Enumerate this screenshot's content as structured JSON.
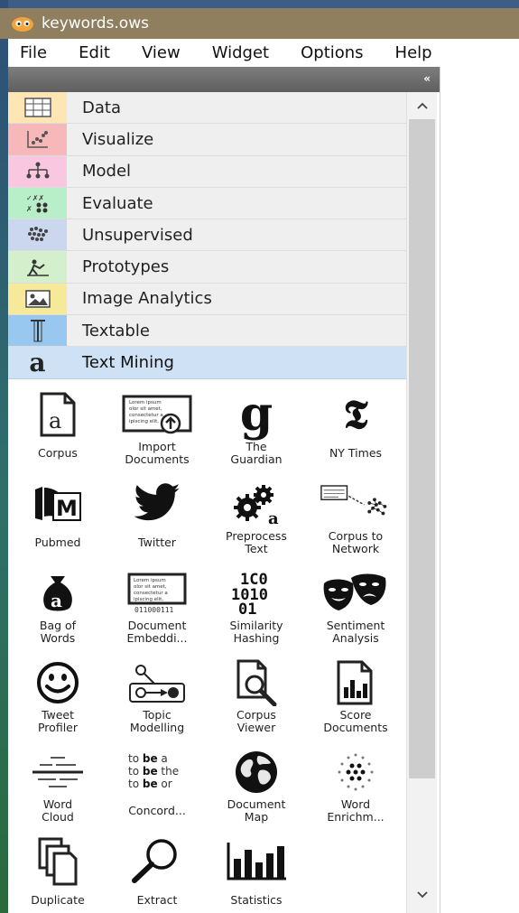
{
  "window": {
    "title": "keywords.ows"
  },
  "menu": [
    "File",
    "Edit",
    "View",
    "Widget",
    "Options",
    "Help"
  ],
  "dock": {
    "collapse_glyph": "«"
  },
  "categories": [
    {
      "label": "Data",
      "icon": "table-icon",
      "color": "#fde6b4"
    },
    {
      "label": "Visualize",
      "icon": "scatter-icon",
      "color": "#f6b8b8"
    },
    {
      "label": "Model",
      "icon": "tree-icon",
      "color": "#f9c7e0"
    },
    {
      "label": "Evaluate",
      "icon": "matrix-icon",
      "color": "#b8eec8"
    },
    {
      "label": "Unsupervised",
      "icon": "cluster-icon",
      "color": "#cad7ef"
    },
    {
      "label": "Prototypes",
      "icon": "digger-icon",
      "color": "#d4efcc"
    },
    {
      "label": "Image Analytics",
      "icon": "image-icon",
      "color": "#f6e99a"
    },
    {
      "label": "Textable",
      "icon": "text-cursor-icon",
      "color": "#98c8ef"
    },
    {
      "label": "Text Mining",
      "icon": "letter-a-icon",
      "color": "#cfe2f5",
      "selected": true
    }
  ],
  "widgets": [
    {
      "label": "Corpus",
      "icon": "corpus-icon"
    },
    {
      "label": "Import\nDocuments",
      "icon": "import-documents-icon"
    },
    {
      "label": "The\nGuardian",
      "icon": "guardian-icon"
    },
    {
      "label": "NY Times",
      "icon": "nytimes-icon"
    },
    {
      "label": "Pubmed",
      "icon": "pubmed-icon"
    },
    {
      "label": "Twitter",
      "icon": "twitter-icon"
    },
    {
      "label": "Preprocess\nText",
      "icon": "preprocess-icon"
    },
    {
      "label": "Corpus to\nNetwork",
      "icon": "corpus-network-icon"
    },
    {
      "label": "Bag of\nWords",
      "icon": "bag-of-words-icon"
    },
    {
      "label": "Document\nEmbeddi...",
      "icon": "document-embedding-icon"
    },
    {
      "label": "Similarity\nHashing",
      "icon": "similarity-hashing-icon"
    },
    {
      "label": "Sentiment\nAnalysis",
      "icon": "sentiment-icon"
    },
    {
      "label": "Tweet\nProfiler",
      "icon": "smiley-icon"
    },
    {
      "label": "Topic\nModelling",
      "icon": "topic-modelling-icon"
    },
    {
      "label": "Corpus\nViewer",
      "icon": "corpus-viewer-icon"
    },
    {
      "label": "Score\nDocuments",
      "icon": "score-documents-icon"
    },
    {
      "label": "Word\nCloud",
      "icon": "word-cloud-icon"
    },
    {
      "label": "Concord...",
      "icon": "concordance-icon"
    },
    {
      "label": "Document\nMap",
      "icon": "globe-icon"
    },
    {
      "label": "Word\nEnrichm...",
      "icon": "word-enrichment-icon"
    },
    {
      "label": "Duplicate",
      "icon": "duplicate-icon"
    },
    {
      "label": "Extract",
      "icon": "magnifier-icon"
    },
    {
      "label": "Statistics",
      "icon": "statistics-icon"
    }
  ],
  "icon_text": {
    "lorem": "Lorem ipsum\nolor sit amet,\nconsectetur a\nipiscing elit,",
    "lorem2": "Lorem ipsum\nolor sit amet,\nconsectetur a\nipiscing elit,",
    "embed_bits": "011000111",
    "hash_bits": "100\n1010\n01",
    "concordance": "to be a\nto be the\nto be or"
  }
}
